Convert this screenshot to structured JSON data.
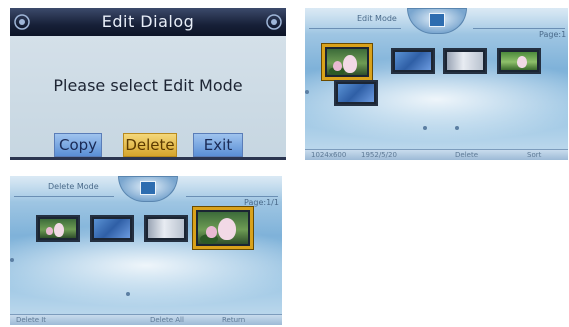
{
  "edit_dialog": {
    "title": "Edit Dialog",
    "message": "Please select Edit Mode",
    "buttons": {
      "copy": "Copy",
      "delete": "Delete",
      "exit": "Exit"
    },
    "colors": {
      "titlebar": "#172038",
      "body": "#c9d8e3",
      "button": "#5a8fd6",
      "button_selected": "#d6a52c"
    }
  },
  "edit_mode": {
    "label": "Edit Mode",
    "page": "Page:1",
    "status": {
      "resolution": "1024x600",
      "size": "1952/5/20",
      "delete": "Delete",
      "sort": "Sort"
    },
    "thumbnails": [
      {
        "name": "flower",
        "selected": true
      },
      {
        "name": "blue",
        "selected": false
      },
      {
        "name": "white",
        "selected": false
      },
      {
        "name": "green",
        "selected": false
      },
      {
        "name": "blue",
        "selected": false
      }
    ]
  },
  "delete_mode": {
    "label": "Delete Mode",
    "page": "Page:1/1",
    "status": {
      "delete_one": "Delete It",
      "delete_all": "Delete All",
      "return": "Return"
    },
    "thumbnails": [
      {
        "name": "flower",
        "selected": false
      },
      {
        "name": "blue",
        "selected": false
      },
      {
        "name": "white",
        "selected": false
      },
      {
        "name": "flower",
        "selected": true
      }
    ]
  }
}
